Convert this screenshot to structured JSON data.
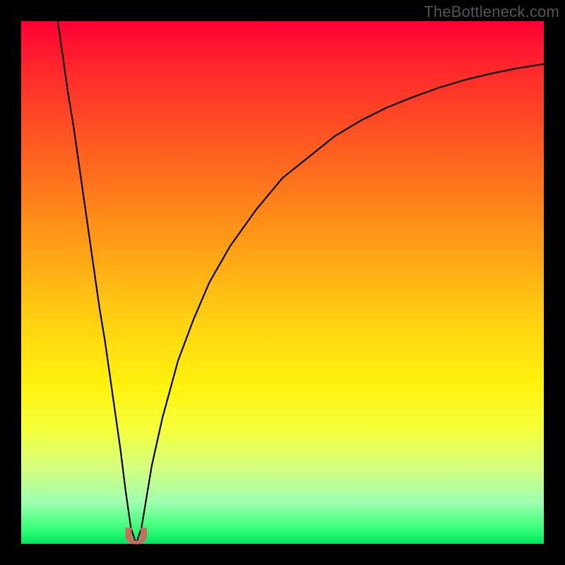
{
  "watermark": "TheBottleneck.com",
  "colors": {
    "background": "#000000",
    "curve_stroke": "#000000",
    "marker_fill": "#cc6b62",
    "marker_stroke": "#cc6b62"
  },
  "chart_data": {
    "type": "line",
    "title": "",
    "xlabel": "",
    "ylabel": "",
    "xlim": [
      0,
      100
    ],
    "ylim": [
      0,
      100
    ],
    "grid": false,
    "legend": false,
    "marker": {
      "x": 22,
      "width": 4,
      "height": 3
    },
    "curve_points": [
      {
        "x": 7,
        "y": 100
      },
      {
        "x": 8,
        "y": 93
      },
      {
        "x": 9,
        "y": 86
      },
      {
        "x": 10,
        "y": 80
      },
      {
        "x": 11,
        "y": 73
      },
      {
        "x": 12,
        "y": 66
      },
      {
        "x": 13,
        "y": 59
      },
      {
        "x": 14,
        "y": 52
      },
      {
        "x": 15,
        "y": 45
      },
      {
        "x": 16,
        "y": 39
      },
      {
        "x": 17,
        "y": 32
      },
      {
        "x": 18,
        "y": 25
      },
      {
        "x": 19,
        "y": 18
      },
      {
        "x": 20,
        "y": 10
      },
      {
        "x": 21,
        "y": 3
      },
      {
        "x": 22,
        "y": 0
      },
      {
        "x": 23,
        "y": 3
      },
      {
        "x": 24,
        "y": 9
      },
      {
        "x": 25,
        "y": 15
      },
      {
        "x": 27,
        "y": 24
      },
      {
        "x": 30,
        "y": 35
      },
      {
        "x": 33,
        "y": 43
      },
      {
        "x": 36,
        "y": 50
      },
      {
        "x": 40,
        "y": 57
      },
      {
        "x": 45,
        "y": 64
      },
      {
        "x": 50,
        "y": 70
      },
      {
        "x": 55,
        "y": 74
      },
      {
        "x": 60,
        "y": 78
      },
      {
        "x": 65,
        "y": 81
      },
      {
        "x": 70,
        "y": 83.5
      },
      {
        "x": 75,
        "y": 85.5
      },
      {
        "x": 80,
        "y": 87.3
      },
      {
        "x": 85,
        "y": 88.8
      },
      {
        "x": 90,
        "y": 90
      },
      {
        "x": 95,
        "y": 91
      },
      {
        "x": 100,
        "y": 91.8
      }
    ]
  }
}
